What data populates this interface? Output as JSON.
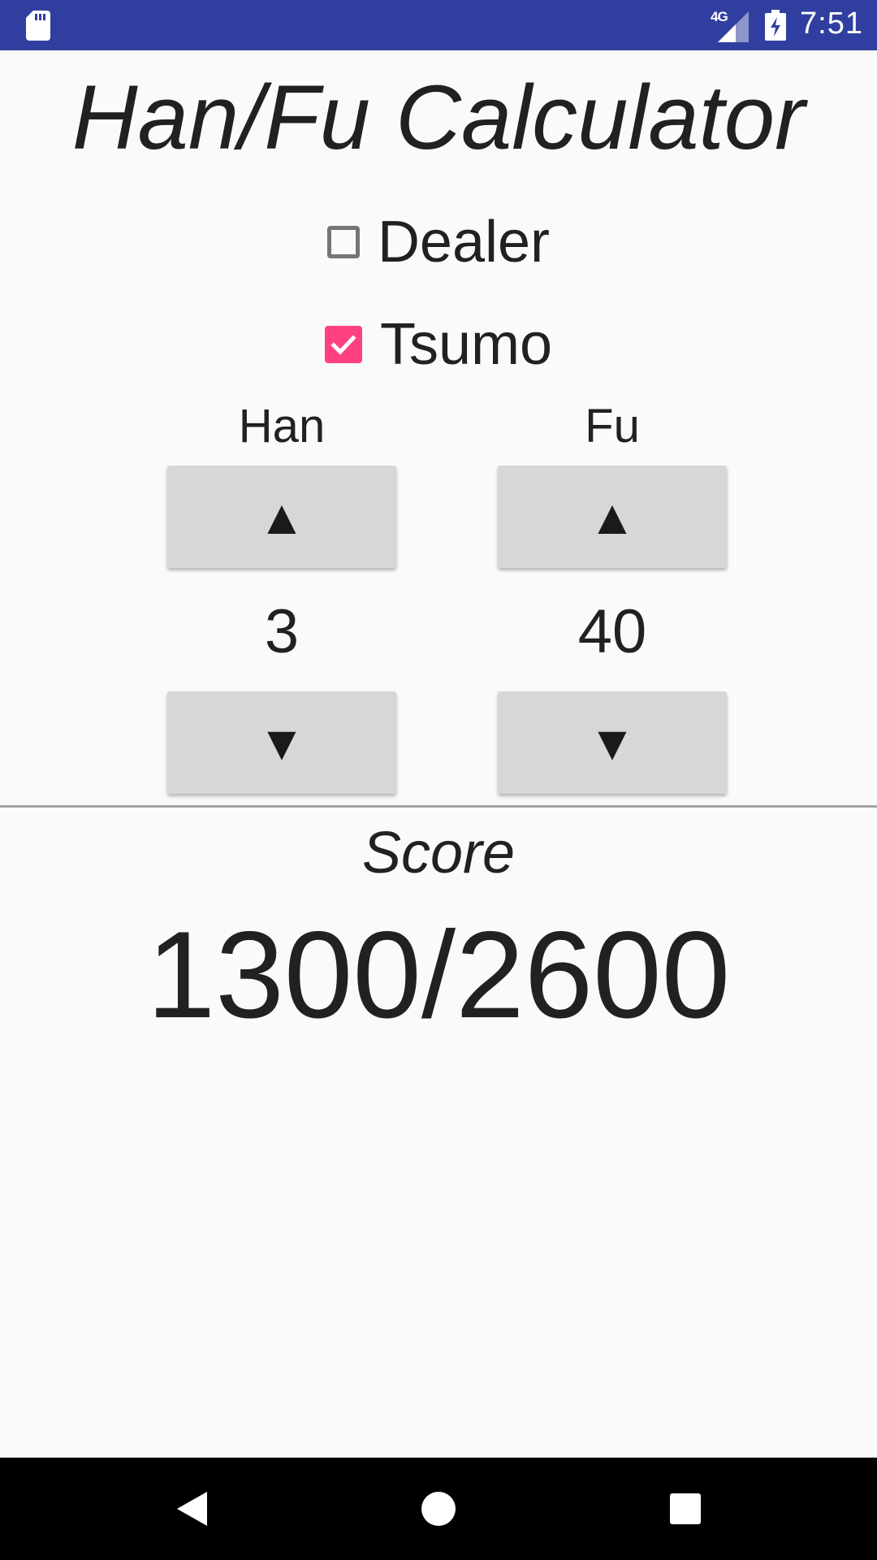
{
  "status_bar": {
    "network_label": "4G",
    "clock": "7:51",
    "icons": [
      "sd-card-icon",
      "signal-icon",
      "battery-charging-icon"
    ],
    "background_color": "#303f9f"
  },
  "app": {
    "title": "Han/Fu Calculator"
  },
  "options": {
    "dealer": {
      "label": "Dealer",
      "checked": false
    },
    "tsumo": {
      "label": "Tsumo",
      "checked": true
    },
    "accent_color": "#ff4081"
  },
  "han": {
    "label": "Han",
    "value": "3",
    "up_label": "▲",
    "down_label": "▼"
  },
  "fu": {
    "label": "Fu",
    "value": "40",
    "up_label": "▲",
    "down_label": "▼"
  },
  "score": {
    "label": "Score",
    "value": "1300/2600"
  },
  "nav_bar": {
    "icons": [
      "back-icon",
      "home-icon",
      "recents-icon"
    ]
  }
}
